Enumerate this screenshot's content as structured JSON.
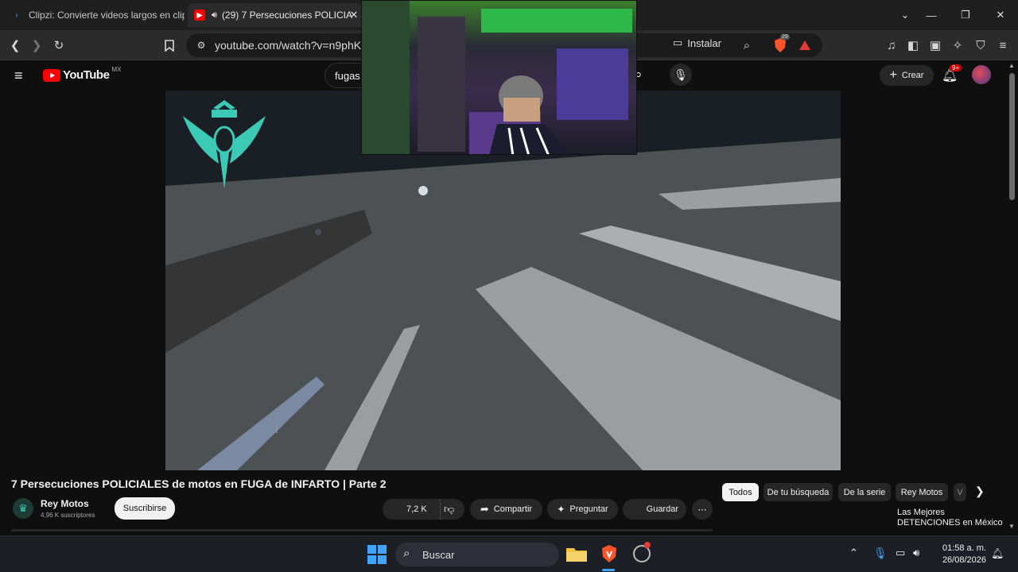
{
  "browser": {
    "tabs": [
      {
        "title": "Clipzi: Convierte videos largos en clip",
        "active": false
      },
      {
        "title": "(29) 7 Persecuciones POLICIA",
        "active": true
      }
    ],
    "url": "youtube.com/watch?v=n9phKaS",
    "install_label": "Instalar",
    "shield_count": "29"
  },
  "youtube": {
    "logo_text": "YouTube",
    "region": "MX",
    "search_value": "fugas",
    "create_label": "Crear",
    "notifications_badge": "9+"
  },
  "video": {
    "title": "7 Persecuciones POLICIALES de motos en FUGA de INFARTO | Parte 2",
    "channel_name": "Rey Motos",
    "subscribers": "4,96 K suscriptores",
    "subscribe_label": "Suscribirse",
    "likes": "7,2 K",
    "share_label": "Compartir",
    "ask_label": "Preguntar",
    "save_label": "Guardar"
  },
  "chips": [
    "Todos",
    "De tu búsqueda",
    "De la serie",
    "Rey Motos",
    "V"
  ],
  "recommendation": {
    "line1": "Las Mejores",
    "line2": "DETENCIONES en México"
  },
  "taskbar": {
    "search_placeholder": "Buscar",
    "time": "01:58 a. m.",
    "date": "26/08/2026"
  },
  "colors": {
    "youtube_red": "#ff0000",
    "accent_blue": "#3ea6ff",
    "brave_orange": "#fb542b"
  }
}
